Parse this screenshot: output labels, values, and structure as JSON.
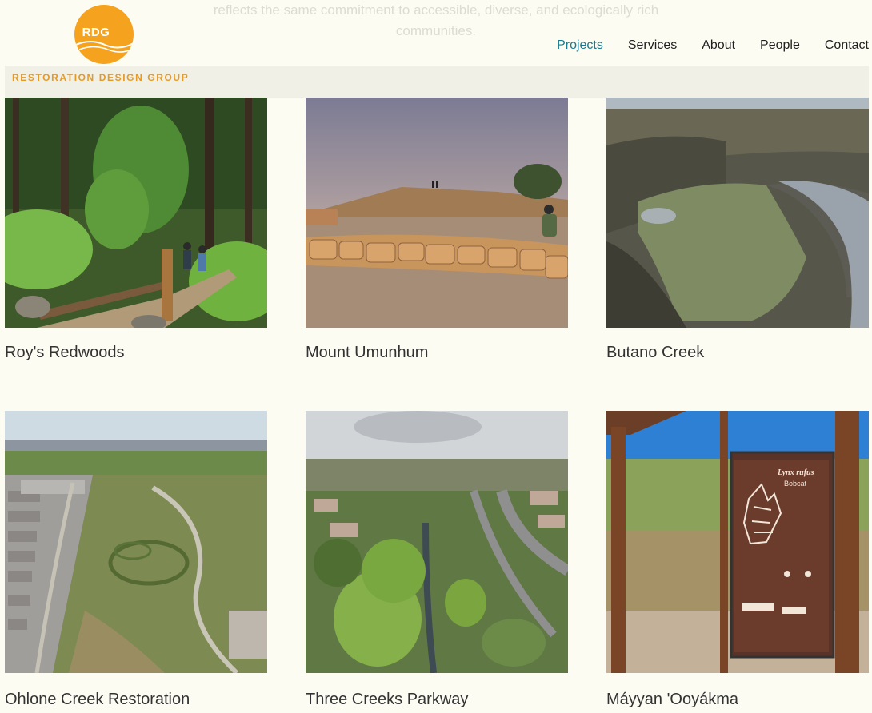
{
  "intro": {
    "line1": "reflects the same commitment to accessible, diverse, and ecologically rich",
    "line2": "communities."
  },
  "logo": {
    "initials": "RDG",
    "wordmark": "RESTORATION DESIGN GROUP",
    "color": "#f5a31f"
  },
  "nav": {
    "items": [
      {
        "label": "Projects",
        "active": true
      },
      {
        "label": "Services"
      },
      {
        "label": "About"
      },
      {
        "label": "People"
      },
      {
        "label": "Contact"
      }
    ],
    "active_color": "#177a8f"
  },
  "projects": [
    {
      "title": "Roy's Redwoods"
    },
    {
      "title": "Mount Umunhum"
    },
    {
      "title": "Butano Creek"
    },
    {
      "title": "Ohlone Creek Restoration"
    },
    {
      "title": "Three Creeks Parkway"
    },
    {
      "title": "Máyyan 'Ooyákma"
    }
  ],
  "sign": {
    "species": "Lynx rufus",
    "common_name": "Bobcat"
  }
}
